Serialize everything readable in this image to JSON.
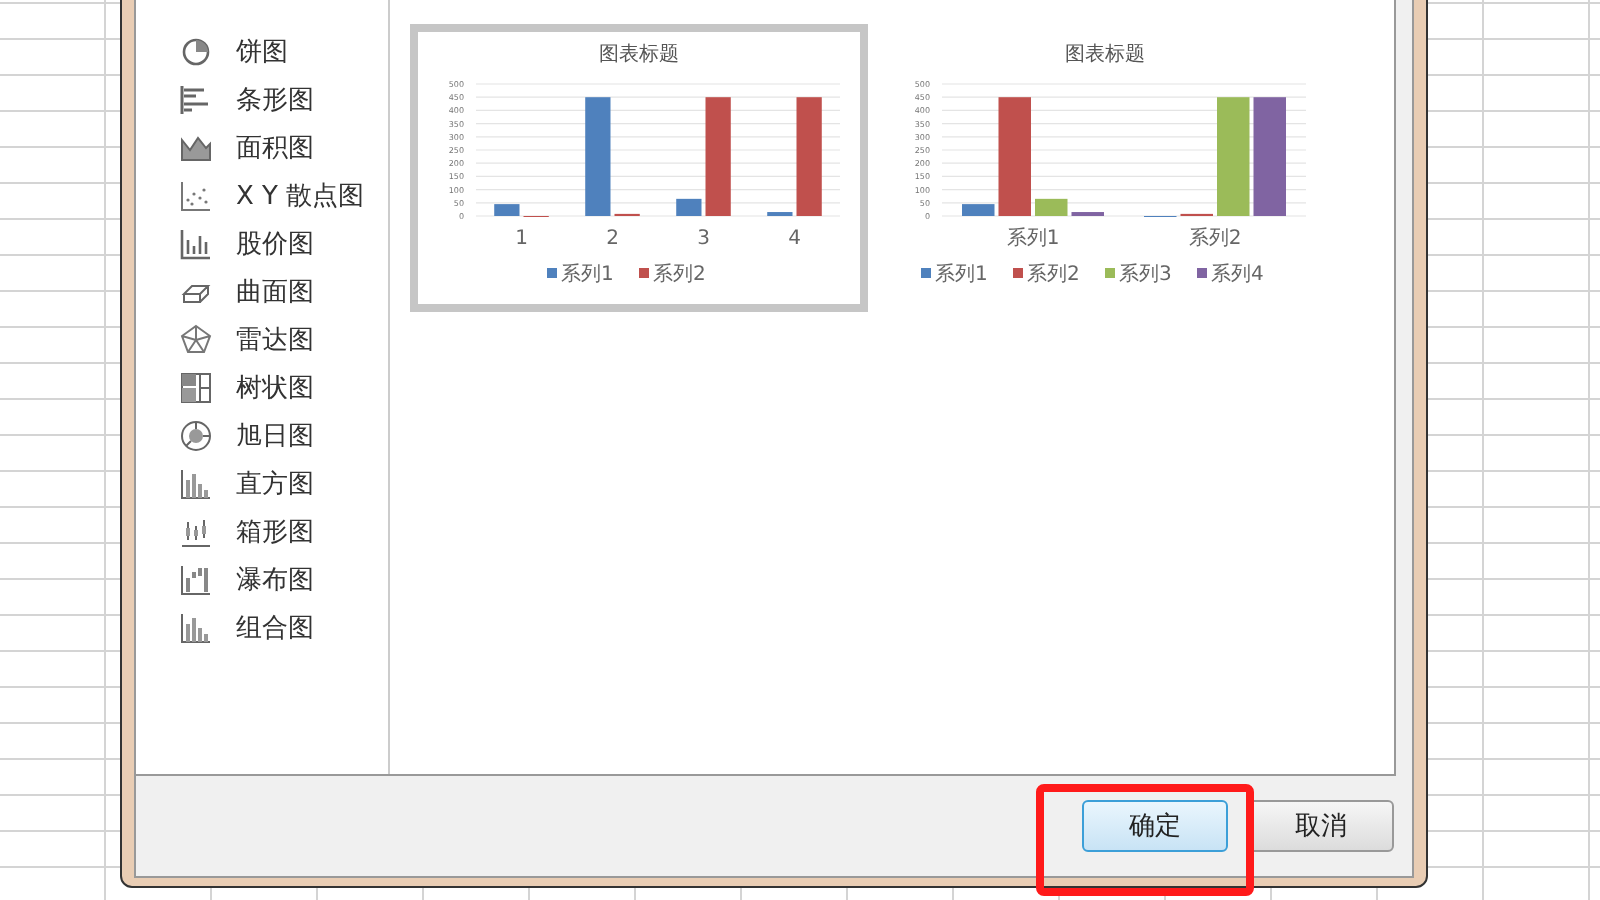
{
  "chart_types": [
    {
      "label": "饼图"
    },
    {
      "label": "条形图"
    },
    {
      "label": "面积图"
    },
    {
      "label": "X Y 散点图"
    },
    {
      "label": "股价图"
    },
    {
      "label": "曲面图"
    },
    {
      "label": "雷达图"
    },
    {
      "label": "树状图"
    },
    {
      "label": "旭日图"
    },
    {
      "label": "直方图"
    },
    {
      "label": "箱形图"
    },
    {
      "label": "瀑布图"
    },
    {
      "label": "组合图"
    }
  ],
  "previews": [
    {
      "selected": true,
      "chart_data": {
        "type": "bar",
        "title": "图表标题",
        "categories": [
          "1",
          "2",
          "3",
          "4"
        ],
        "series": [
          {
            "name": "系列1",
            "color": "#4f81bd",
            "values": [
              45,
              450,
              65,
              15
            ]
          },
          {
            "name": "系列2",
            "color": "#c0504d",
            "values": [
              0,
              8,
              450,
              450
            ]
          }
        ],
        "grid": true,
        "legend": true,
        "ylim": [
          0,
          500
        ],
        "yticks": [
          0,
          50,
          100,
          150,
          200,
          250,
          300,
          350,
          400,
          450,
          500
        ]
      }
    },
    {
      "selected": false,
      "chart_data": {
        "type": "bar",
        "title": "图表标题",
        "categories": [
          "系列1",
          "系列2"
        ],
        "series": [
          {
            "name": "系列1",
            "color": "#4f81bd",
            "values": [
              45,
              0
            ]
          },
          {
            "name": "系列2",
            "color": "#c0504d",
            "values": [
              450,
              8
            ]
          },
          {
            "name": "系列3",
            "color": "#9bbb59",
            "values": [
              65,
              450
            ]
          },
          {
            "name": "系列4",
            "color": "#8064a2",
            "values": [
              15,
              450
            ]
          }
        ],
        "grid": true,
        "legend": true,
        "ylim": [
          0,
          500
        ],
        "yticks": [
          0,
          50,
          100,
          150,
          200,
          250,
          300,
          350,
          400,
          450,
          500
        ]
      }
    }
  ],
  "buttons": [
    {
      "label": "确定",
      "default": true
    },
    {
      "label": "取消",
      "default": false
    }
  ]
}
